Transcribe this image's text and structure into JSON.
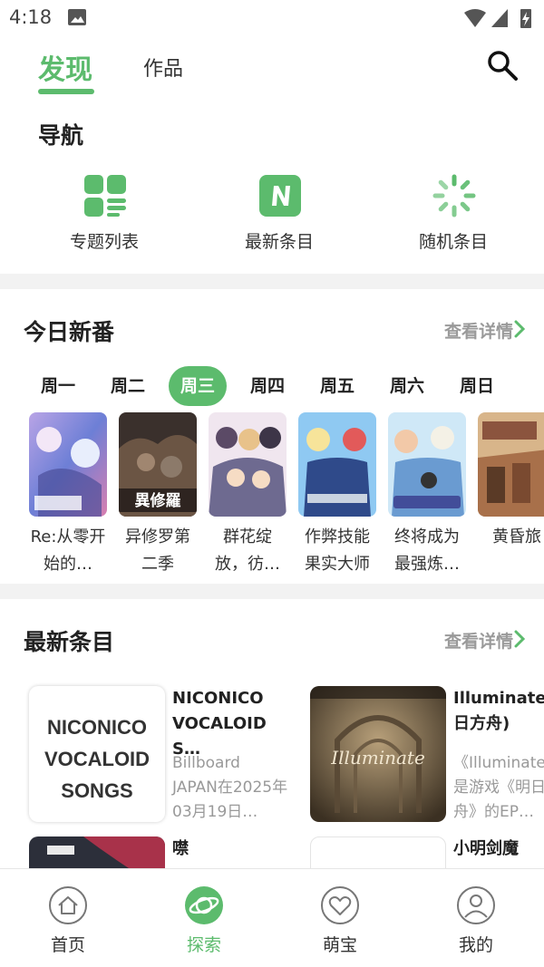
{
  "status_bar": {
    "time": "4:18"
  },
  "header": {
    "tabs": [
      {
        "label": "发现",
        "active": true
      },
      {
        "label": "作品",
        "active": false
      }
    ]
  },
  "nav_section": {
    "title": "导航",
    "items": [
      {
        "label": "专题列表",
        "icon": "grid-icon"
      },
      {
        "label": "最新条目",
        "icon": "new-n-icon"
      },
      {
        "label": "随机条目",
        "icon": "spinner-icon"
      }
    ]
  },
  "today": {
    "title": "今日新番",
    "more": "查看详情",
    "weekdays": [
      "周一",
      "周二",
      "周三",
      "周四",
      "周五",
      "周六",
      "周日"
    ],
    "selected_weekday": "周三",
    "anime": [
      {
        "name": "Re:从零开始的…"
      },
      {
        "name": "异修罗第二季",
        "cover_text": "異修羅"
      },
      {
        "name": "群花绽放，彷…"
      },
      {
        "name": "作弊技能果实大师"
      },
      {
        "name": "终将成为最强炼…"
      },
      {
        "name": "黄昏旅"
      }
    ]
  },
  "latest": {
    "title": "最新条目",
    "more": "查看详情",
    "entries": [
      {
        "title": "NICONICO VOCALOID S…",
        "cover_text": "NICONICO VOCALOID SONGS",
        "desc": "Billboard JAPAN在2025年03月19日…"
      },
      {
        "title": "Illuminate (明日方舟)",
        "cover_text": "Illuminate",
        "desc": "《Illuminate》是游戏《明日方舟》的EP…"
      },
      {
        "title": "噤",
        "desc": ""
      },
      {
        "title": "小明剑魔",
        "desc": ""
      }
    ]
  },
  "bottom_nav": [
    {
      "label": "首页",
      "icon": "home-icon",
      "active": false
    },
    {
      "label": "探索",
      "icon": "planet-icon",
      "active": true
    },
    {
      "label": "萌宝",
      "icon": "heart-icon",
      "active": false
    },
    {
      "label": "我的",
      "icon": "person-icon",
      "active": false
    }
  ],
  "colors": {
    "accent": "#5cbb6d",
    "muted_text": "#999999"
  }
}
